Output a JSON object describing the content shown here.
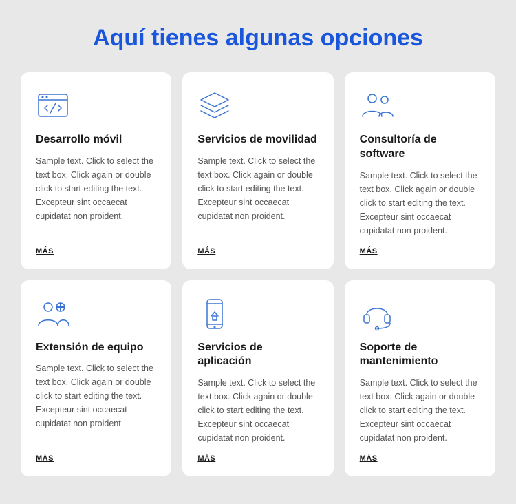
{
  "page": {
    "title": "Aquí tienes algunas opciones",
    "background": "#e8e8e8"
  },
  "cards": [
    {
      "id": "mobile-dev",
      "title": "Desarrollo móvil",
      "text": "Sample text. Click to select the text box. Click again or double click to start editing the text. Excepteur sint occaecat cupidatat non proident.",
      "link": "MÁS",
      "icon": "mobile-dev-icon"
    },
    {
      "id": "mobility-services",
      "title": "Servicios de movilidad",
      "text": "Sample text. Click to select the text box. Click again or double click to start editing the text. Excepteur sint occaecat cupidatat non proident.",
      "link": "MÁS",
      "icon": "mobility-icon"
    },
    {
      "id": "software-consulting",
      "title": "Consultoría de software",
      "text": "Sample text. Click to select the text box. Click again or double click to start editing the text. Excepteur sint occaecat cupidatat non proident.",
      "link": "MÁS",
      "icon": "consulting-icon"
    },
    {
      "id": "team-extension",
      "title": "Extensión de equipo",
      "text": "Sample text. Click to select the text box. Click again or double click to start editing the text. Excepteur sint occaecat cupidatat non proident.",
      "link": "MÁS",
      "icon": "team-icon"
    },
    {
      "id": "app-services",
      "title": "Servicios de aplicación",
      "text": "Sample text. Click to select the text box. Click again or double click to start editing the text. Excepteur sint occaecat cupidatat non proident.",
      "link": "MÁS",
      "icon": "app-icon"
    },
    {
      "id": "maintenance-support",
      "title": "Soporte de mantenimiento",
      "text": "Sample text. Click to select the text box. Click again or double click to start editing the text. Excepteur sint occaecat cupidatat non proident.",
      "link": "MÁS",
      "icon": "support-icon"
    }
  ]
}
